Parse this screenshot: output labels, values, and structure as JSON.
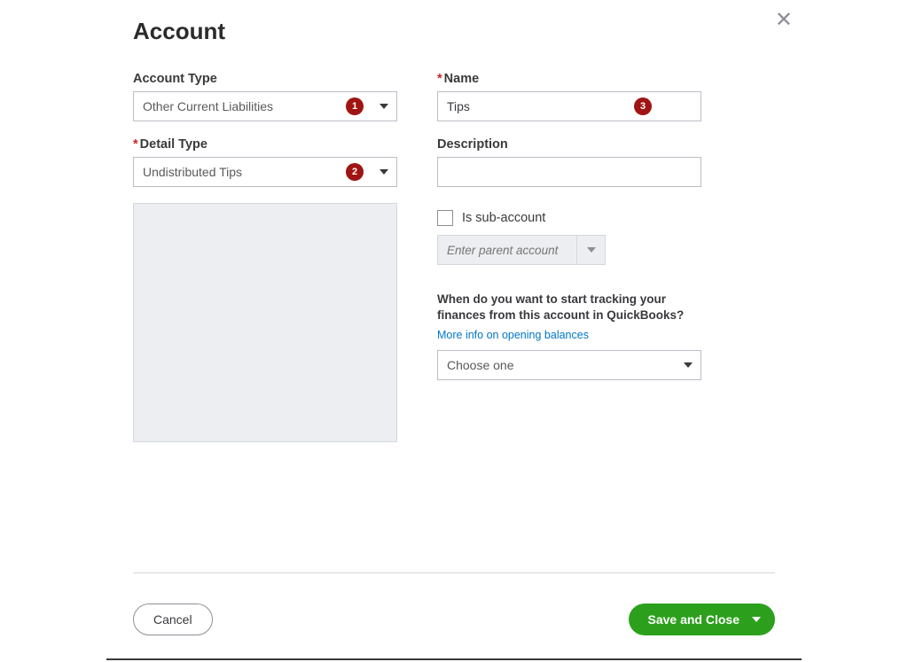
{
  "title": "Account",
  "labels": {
    "account_type": "Account Type",
    "detail_type": "Detail Type",
    "name": "Name",
    "description": "Description",
    "sub_account": "Is sub-account",
    "parent_placeholder": "Enter parent account",
    "tracking_question": "When do you want to start tracking your finances from this account in QuickBooks?",
    "more_info": "More info on opening balances"
  },
  "values": {
    "account_type": "Other Current Liabilities",
    "detail_type": "Undistributed Tips",
    "name": "Tips",
    "description": "",
    "tracking_select": "Choose one"
  },
  "badges": {
    "b1": "1",
    "b2": "2",
    "b3": "3"
  },
  "buttons": {
    "cancel": "Cancel",
    "save": "Save and Close"
  }
}
